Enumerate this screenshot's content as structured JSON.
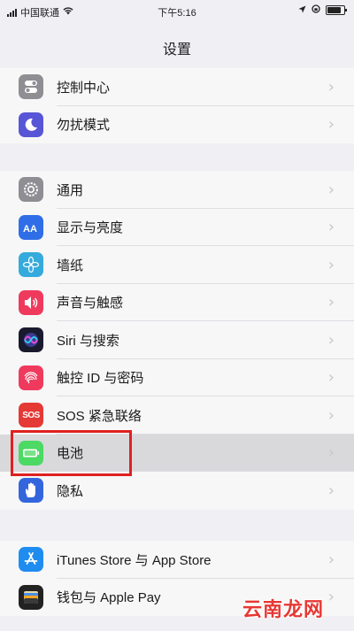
{
  "status_bar": {
    "carrier": "中国联通",
    "time": "下午5:16"
  },
  "nav": {
    "title": "设置"
  },
  "groups": [
    {
      "items": [
        {
          "label": "控制中心",
          "icon": "control-center-icon",
          "color": "#8e8e93"
        },
        {
          "label": "勿扰模式",
          "icon": "moon-icon",
          "color": "#5856d6"
        }
      ]
    },
    {
      "items": [
        {
          "label": "通用",
          "icon": "gear-icon",
          "color": "#8e8e93"
        },
        {
          "label": "显示与亮度",
          "icon": "text-size-icon",
          "color": "#2f6ee6"
        },
        {
          "label": "墙纸",
          "icon": "wallpaper-flower-icon",
          "color": "#35aadc"
        },
        {
          "label": "声音与触感",
          "icon": "speaker-icon",
          "color": "#ef3a5d"
        },
        {
          "label": "Siri 与搜索",
          "icon": "siri-icon",
          "color": "#1a1a2e"
        },
        {
          "label": "触控 ID 与密码",
          "icon": "fingerprint-icon",
          "color": "#ef3a5d"
        },
        {
          "label": "SOS 紧急联络",
          "icon": "sos-icon",
          "color": "#e53935",
          "icon_text": "SOS"
        },
        {
          "label": "电池",
          "icon": "battery-icon",
          "color": "#4cd964",
          "highlighted": true
        },
        {
          "label": "隐私",
          "icon": "hand-icon",
          "color": "#3366dd"
        }
      ]
    },
    {
      "items": [
        {
          "label": "iTunes Store 与 App Store",
          "icon": "app-store-icon",
          "color": "#1f8cf0"
        },
        {
          "label": "钱包与 Apple Pay",
          "icon": "wallet-icon",
          "color": "#222222"
        }
      ]
    }
  ],
  "watermark": "云南龙网",
  "highlight_color": "#e02020"
}
